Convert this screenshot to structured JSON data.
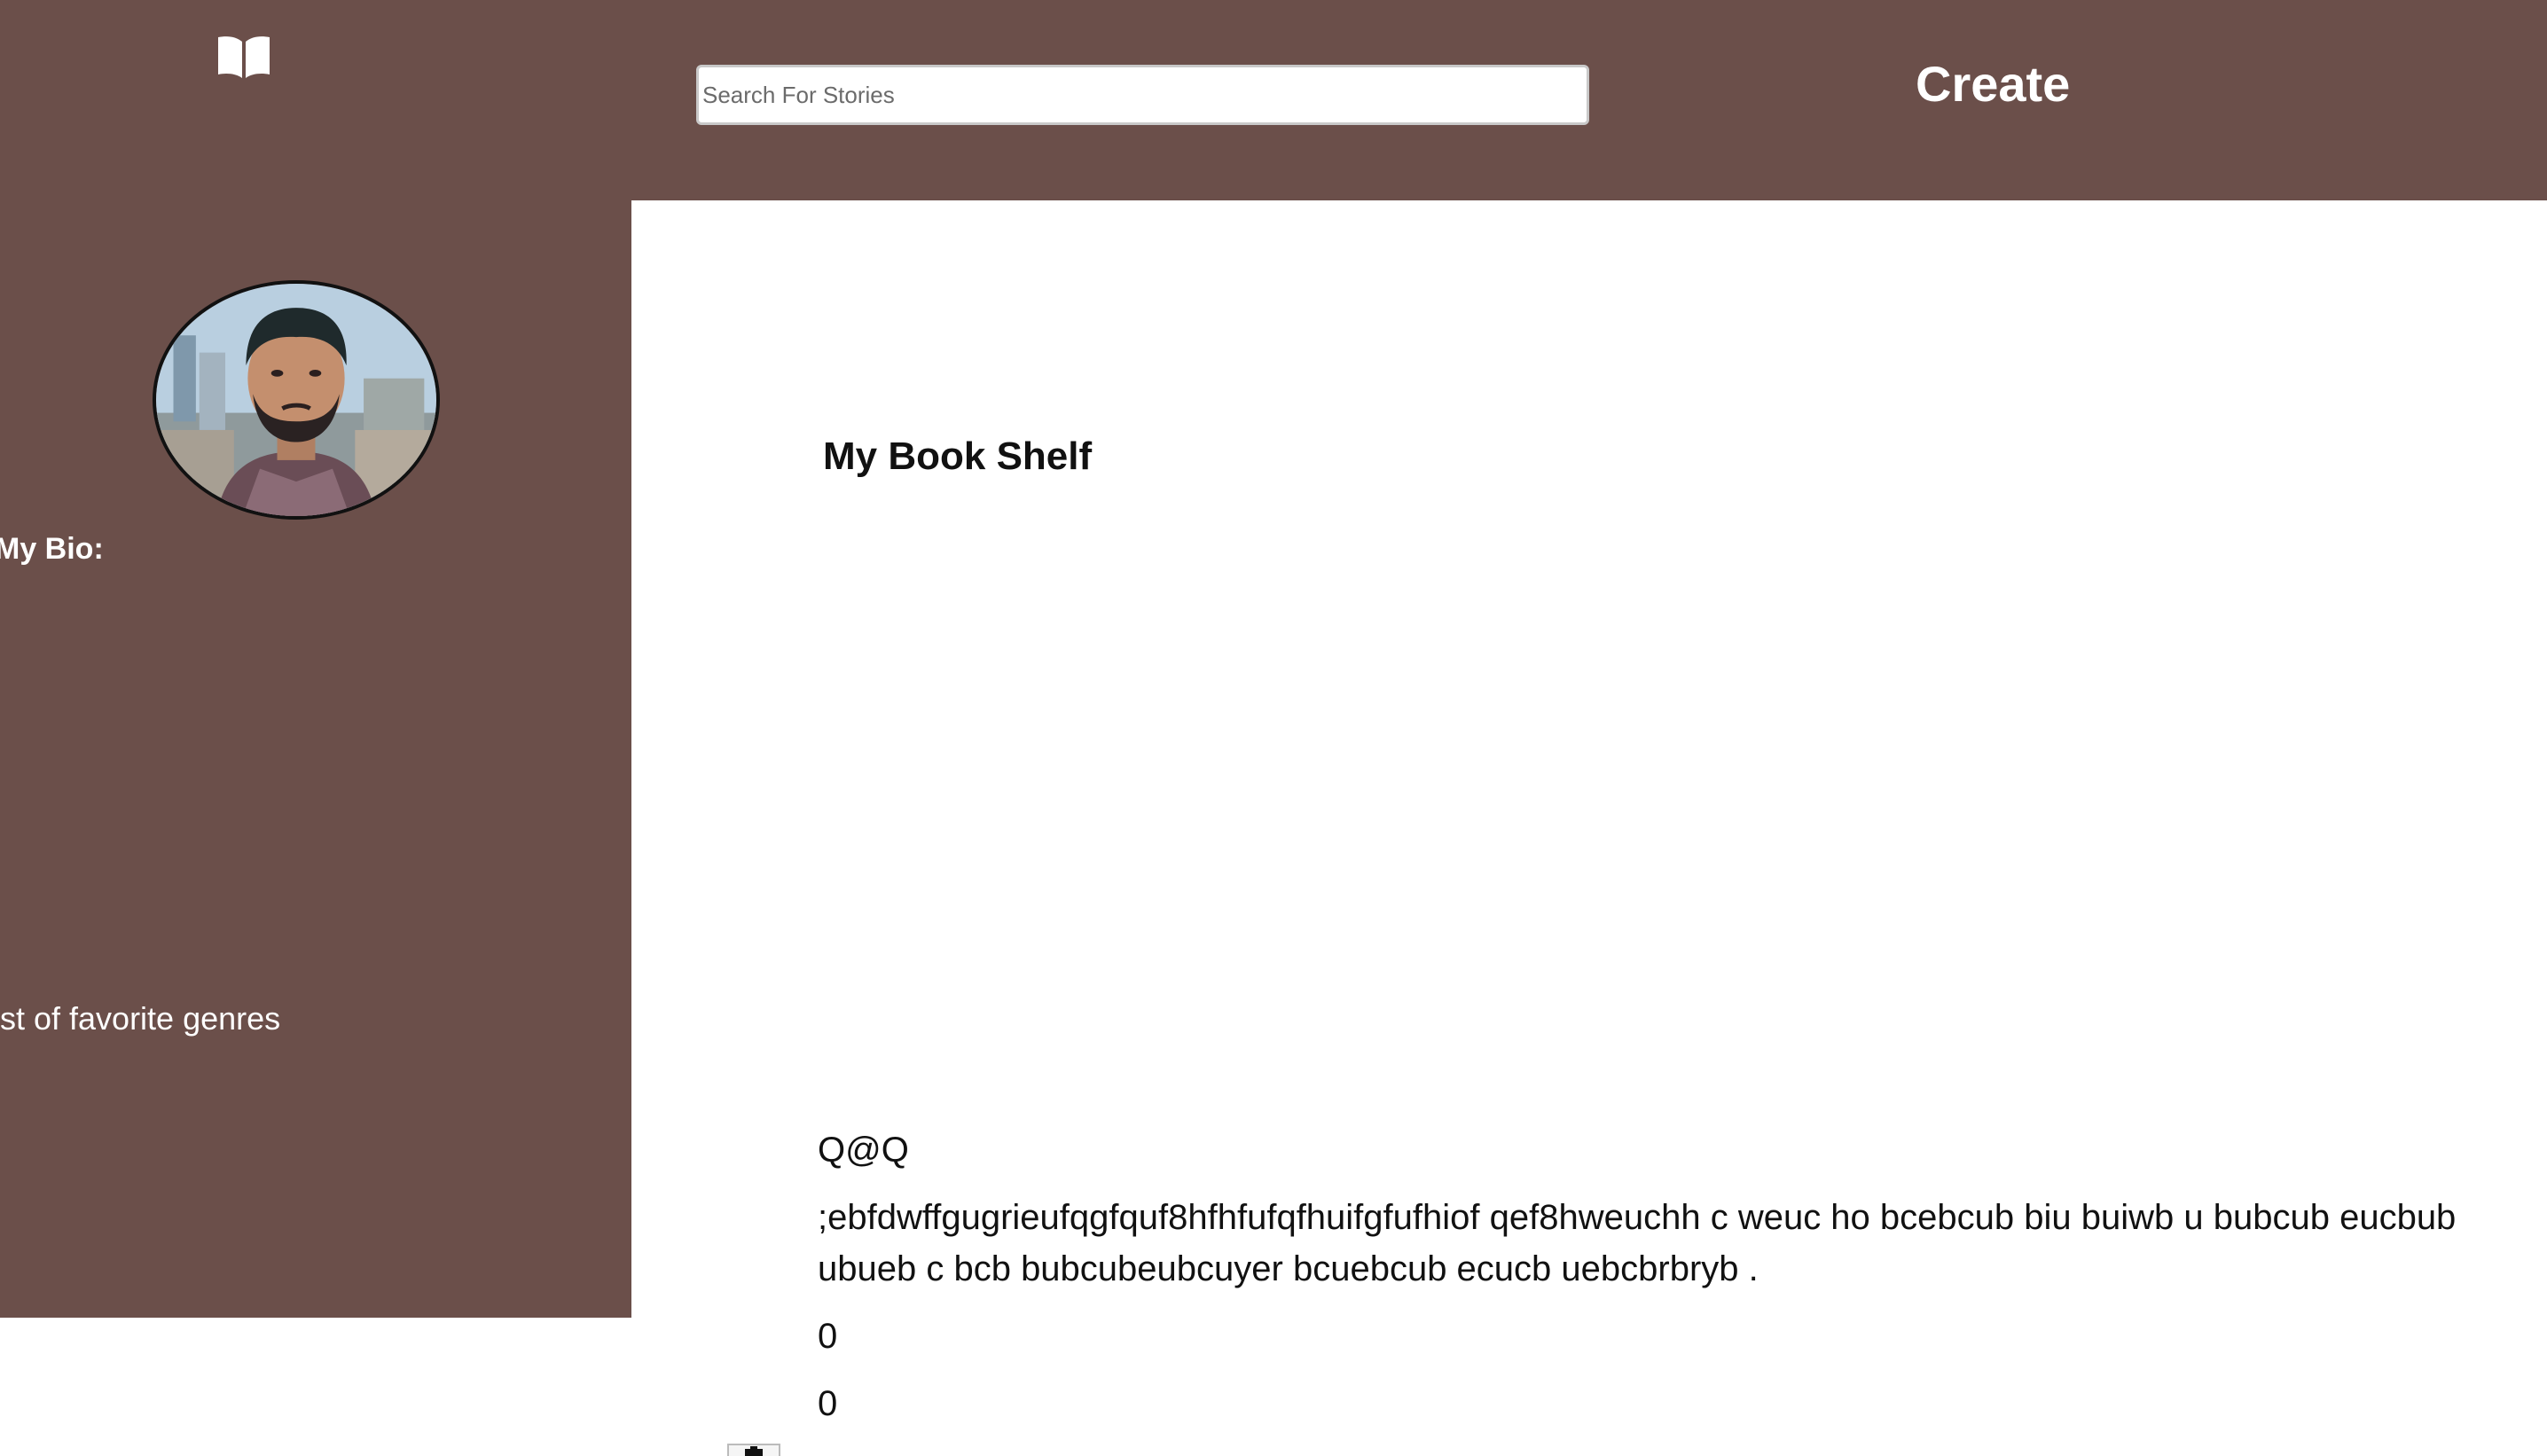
{
  "header": {
    "logo_icon": "open-book-icon",
    "search": {
      "placeholder": "Search For Stories",
      "value": ""
    },
    "create_label": "Create",
    "background": "#6b4f4a"
  },
  "sidebar": {
    "avatar_icon": "profile-photo",
    "bio_label": "My Bio:",
    "genres_label": "ist of favorite genres"
  },
  "main": {
    "shelf_title": "My Book Shelf",
    "stories": [
      {
        "title": "Q@Q",
        "body": ";ebfdwffgugrieufqgfquf8hfhfufqfhuifgfufhiof qef8hweuchh c weuc ho bcebcub biu buiwb u bubcub eucbub ubueb c bcb bubcubeubcuyer bcuebcub ecucb uebcbrbryb .",
        "count_a": "0",
        "count_b": "0",
        "delete_icon": "trash-icon"
      }
    ]
  }
}
